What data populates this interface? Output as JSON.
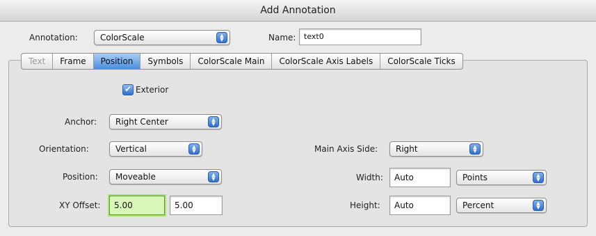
{
  "window": {
    "title": "Add Annotation"
  },
  "header": {
    "annotation_label": "Annotation:",
    "annotation_value": "ColorScale",
    "name_label": "Name:",
    "name_value": "text0"
  },
  "tabs": [
    {
      "label": "Text",
      "state": "disabled"
    },
    {
      "label": "Frame",
      "state": "normal"
    },
    {
      "label": "Position",
      "state": "selected"
    },
    {
      "label": "Symbols",
      "state": "normal"
    },
    {
      "label": "ColorScale Main",
      "state": "normal"
    },
    {
      "label": "ColorScale Axis Labels",
      "state": "normal"
    },
    {
      "label": "ColorScale Ticks",
      "state": "normal"
    }
  ],
  "position_tab": {
    "exterior": {
      "label": "Exterior",
      "checked": true
    },
    "anchor": {
      "label": "Anchor:",
      "value": "Right Center"
    },
    "orientation": {
      "label": "Orientation:",
      "value": "Vertical"
    },
    "position": {
      "label": "Position:",
      "value": "Moveable"
    },
    "xy_offset": {
      "label": "XY Offset:",
      "x": "5.00",
      "y": "5.00"
    },
    "main_axis_side": {
      "label": "Main Axis Side:",
      "value": "Right"
    },
    "width": {
      "label": "Width:",
      "value": "Auto",
      "units": "Points"
    },
    "height": {
      "label": "Height:",
      "value": "Auto",
      "units": "Percent"
    }
  },
  "icons": {
    "popup_arrows": "updown-arrows-icon",
    "checkmark": "checkmark-icon"
  },
  "colors": {
    "accent": "#4a8ee0",
    "focus_field": "#d9f7b8"
  }
}
